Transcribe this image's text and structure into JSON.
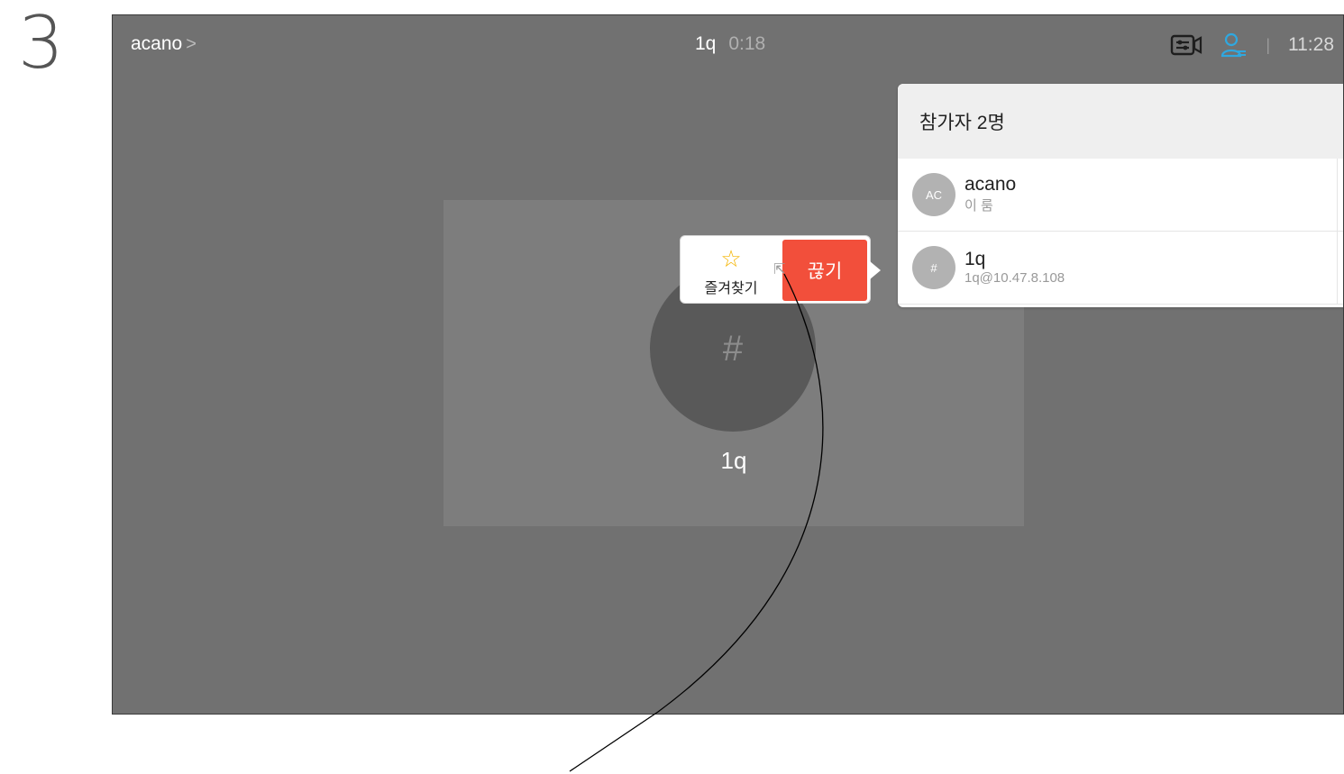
{
  "step_number": "3",
  "topbar": {
    "breadcrumb": "acano",
    "breadcrumb_chevron": ">",
    "call_name": "1q",
    "call_duration": "0:18",
    "separator": "|",
    "clock": "11:28"
  },
  "icons": {
    "layout": "layout-control-icon",
    "participants": "participants-icon",
    "favorite": "star-icon",
    "cursor": "pointer-cursor-icon"
  },
  "video_tile": {
    "avatar_glyph": "#",
    "name": "1q"
  },
  "action_popup": {
    "favorite_glyph": "☆",
    "favorite_label": "즐겨찾기",
    "end_label": "끊기"
  },
  "participants_panel": {
    "title": "참가자 2명",
    "items": [
      {
        "initials": "AC",
        "name": "acano",
        "subtitle": "이 룸"
      },
      {
        "initials": "#",
        "name": "1q",
        "subtitle": "1q@10.47.8.108"
      }
    ]
  },
  "colors": {
    "screen_bg": "#717171",
    "end_button": "#f24f3b",
    "star": "#f5b400",
    "participants_icon": "#2fa8e0"
  }
}
